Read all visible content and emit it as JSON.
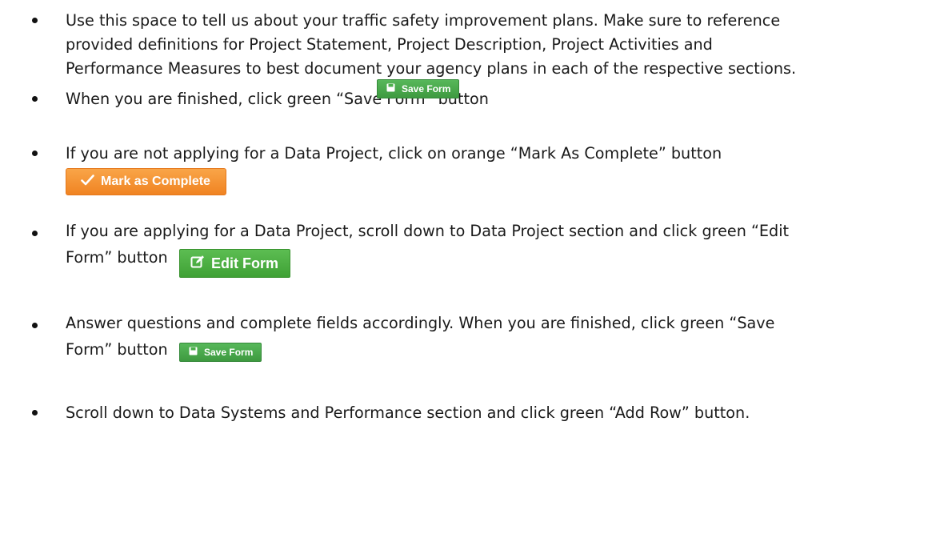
{
  "items": [
    {
      "lines": [
        "Use this space to tell us about your traffic safety improvement plans.  Make sure to reference",
        "provided definitions for Project Statement, Project Description, Project Activities and",
        "Performance Measures to best document your agency plans in each of the respective sections."
      ]
    },
    {
      "lines": [
        "When you are finished, click green “Save Form” button"
      ],
      "button": {
        "label": "Save Form",
        "icon": "floppy-disk-icon",
        "color": "#4cae4c"
      }
    },
    {
      "lines": [
        "If you are not applying for a Data Project, click on orange “Mark As Complete” button"
      ],
      "button": {
        "label": "Mark as Complete",
        "icon": "checkmark-icon",
        "color": "#f39c3a"
      }
    },
    {
      "lines": [
        "If you are applying for a Data Project, scroll down to Data Project section and click green “Edit",
        "Form” button"
      ],
      "button": {
        "label": "Edit Form",
        "icon": "edit-icon",
        "color": "#4cb04a"
      }
    },
    {
      "lines": [
        "Answer questions and complete fields accordingly.  When you are finished, click green “Save",
        "Form” button"
      ],
      "button": {
        "label": "Save Form",
        "icon": "floppy-disk-icon",
        "color": "#4cae4c"
      }
    },
    {
      "lines": [
        "Scroll down to Data Systems and Performance section and click green “Add Row” button."
      ]
    }
  ]
}
